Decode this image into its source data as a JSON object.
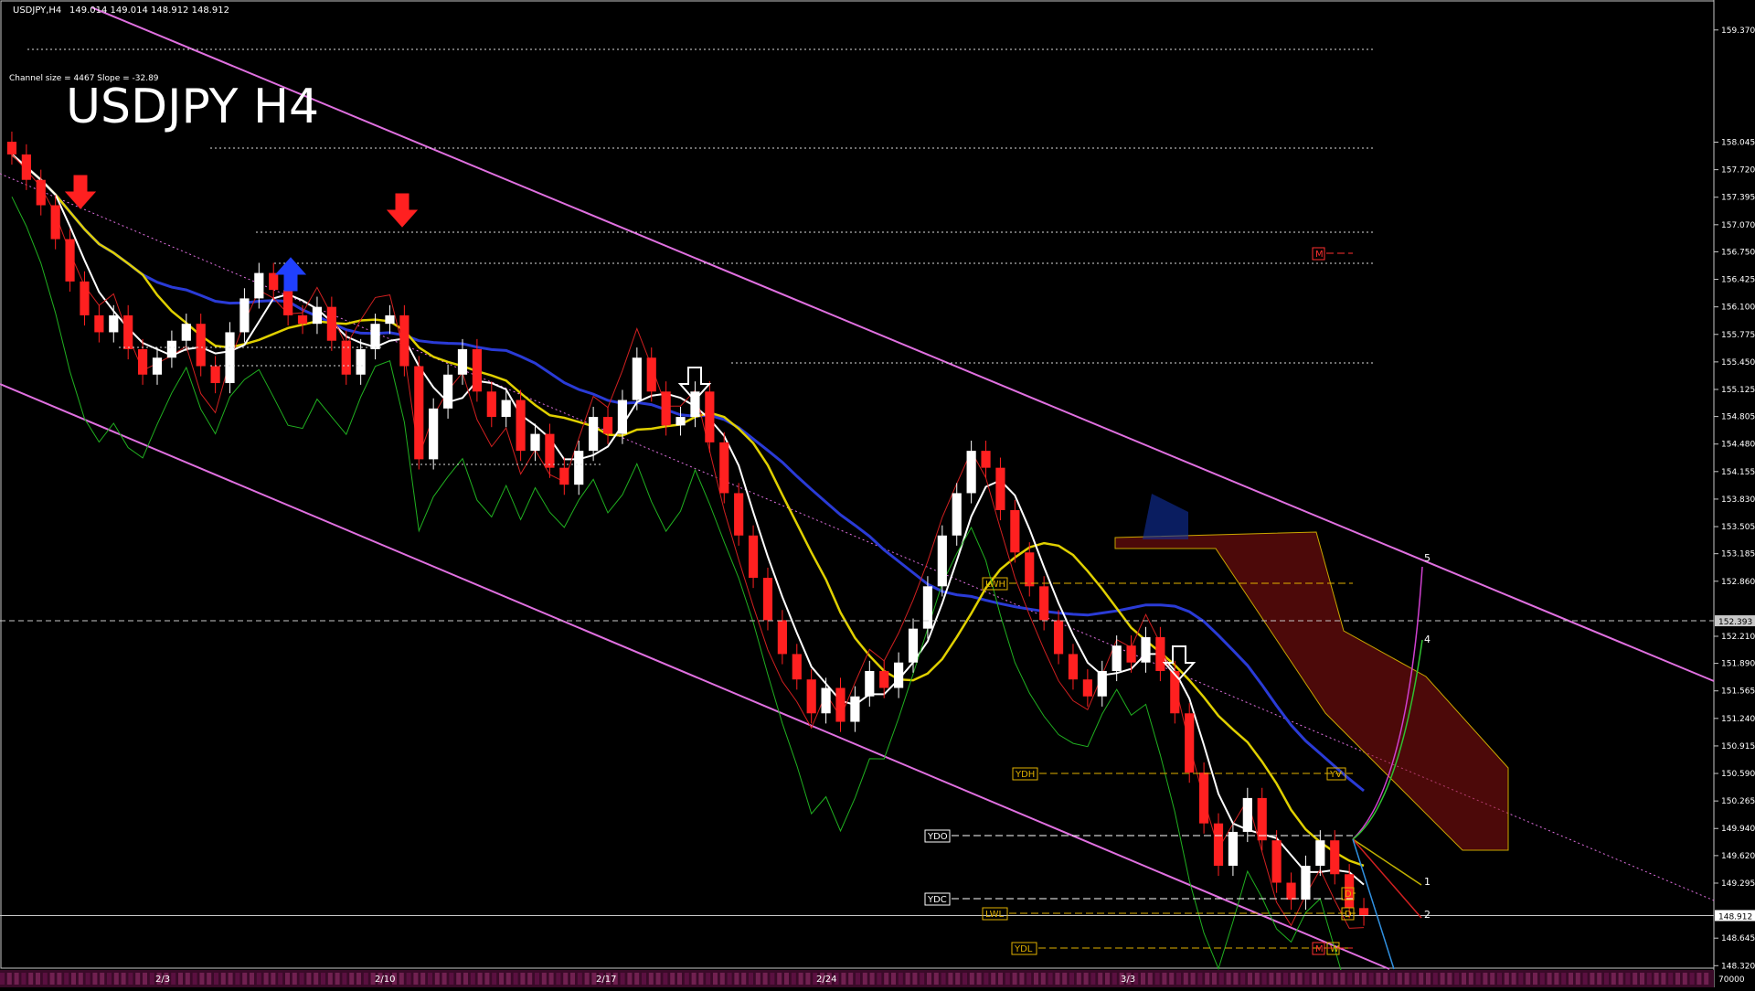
{
  "header": {
    "symbol_tf": "USDJPY,H4",
    "ohlc": "149.014 149.014 148.912 148.912",
    "indicator_info": "Channel size = 4467 Slope = -32.89",
    "big_title": "USDJPY H4"
  },
  "chart_data": {
    "type": "candlestick",
    "y_ticks": [
      "159.370",
      "158.045",
      "157.720",
      "157.395",
      "157.070",
      "156.750",
      "156.425",
      "156.100",
      "155.775",
      "155.450",
      "155.125",
      "154.805",
      "154.480",
      "154.155",
      "153.830",
      "153.505",
      "153.185",
      "152.860",
      "152.210",
      "151.890",
      "151.565",
      "151.240",
      "150.915",
      "150.590",
      "150.265",
      "149.940",
      "149.620",
      "149.295",
      "148.645",
      "148.320"
    ],
    "x_ticks": [
      "2/3",
      "2/10",
      "2/17",
      "2/24",
      "3/3"
    ],
    "price_label": "148.912",
    "hline_label": "152.393",
    "volume_label": "70000",
    "ylim": [
      148.28,
      159.4
    ],
    "level_labels": [
      "YDH",
      "YDO",
      "YDC",
      "LWL",
      "YDL",
      "LWH",
      "YV",
      "D",
      "D",
      "W",
      "M",
      "M"
    ],
    "wave_labels": [
      "1",
      "2",
      "4",
      "5"
    ],
    "series": [
      {
        "name": "close",
        "values": [
          157.9,
          157.6,
          157.3,
          156.9,
          156.4,
          156.0,
          155.8,
          156.0,
          155.6,
          155.3,
          155.5,
          155.7,
          155.9,
          155.4,
          155.2,
          155.8,
          156.2,
          156.5,
          156.3,
          156.0,
          155.9,
          156.1,
          155.7,
          155.3,
          155.6,
          155.9,
          156.0,
          155.4,
          154.3,
          154.9,
          155.3,
          155.6,
          155.1,
          154.8,
          155.0,
          154.4,
          154.6,
          154.2,
          154.0,
          154.4,
          154.8,
          154.6,
          155.0,
          155.5,
          155.1,
          154.7,
          154.8,
          155.1,
          154.5,
          153.9,
          153.4,
          152.9,
          152.4,
          152.0,
          151.7,
          151.3,
          151.6,
          151.2,
          151.5,
          151.8,
          151.6,
          151.9,
          152.3,
          152.8,
          153.4,
          153.9,
          154.4,
          154.2,
          153.7,
          153.2,
          152.8,
          152.4,
          152.0,
          151.7,
          151.5,
          151.8,
          152.1,
          151.9,
          152.2,
          151.8,
          151.3,
          150.6,
          150.0,
          149.5,
          149.9,
          150.3,
          149.8,
          149.3,
          149.1,
          149.5,
          149.8,
          149.4,
          149.0,
          148.912
        ]
      }
    ]
  }
}
